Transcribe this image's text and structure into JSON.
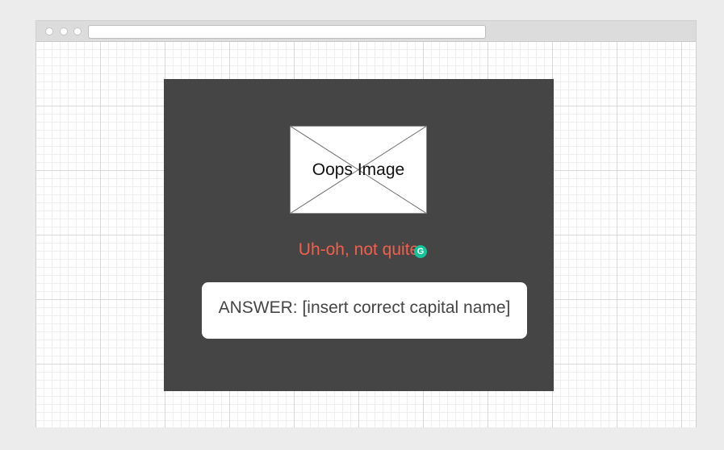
{
  "window": {
    "address": ""
  },
  "card": {
    "image_label": "Oops Image",
    "feedback": "Uh-oh, not quite",
    "grammarly_badge": "G",
    "answer": "ANSWER: [insert correct capital name]"
  },
  "colors": {
    "panel_background": "#454545",
    "feedback_text": "#f0604d",
    "badge": "#15c39a"
  },
  "icons": {
    "image_placeholder": "image-placeholder-cross-icon",
    "badge": "grammarly-icon"
  }
}
